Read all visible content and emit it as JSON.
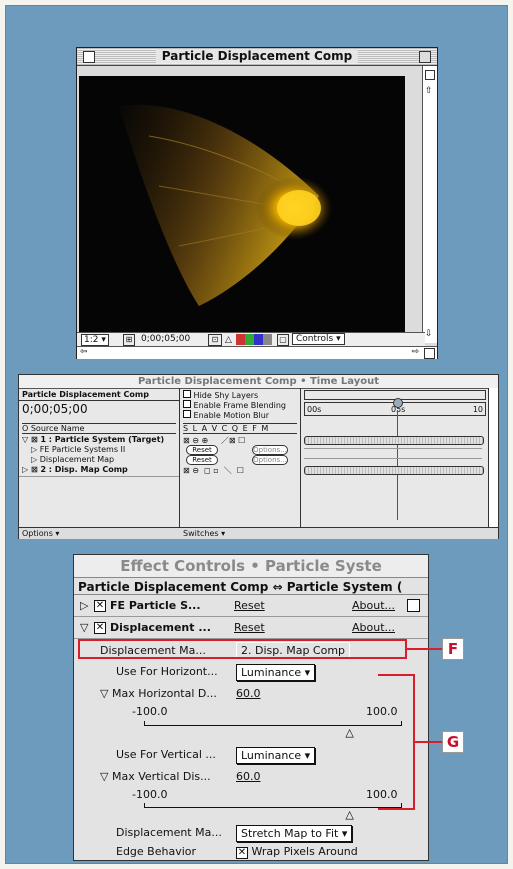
{
  "comp_window": {
    "title": "Particle Displacement Comp",
    "status": {
      "zoom": "1:2",
      "timecode": "0;00;05;00",
      "controls_label": "Controls"
    }
  },
  "time_layout": {
    "title": "Particle Displacement Comp • Time Layout",
    "comp_name": "Particle Displacement Comp",
    "timecode": "0;00;05;00",
    "options": [
      "Hide Shy Layers",
      "Enable Frame Blending",
      "Enable Motion Blur"
    ],
    "ruler": {
      "start": "00s",
      "mid": "05s",
      "end": "10"
    },
    "source_name_header": "O Source Name",
    "switch_header": "S L A V C Q E F M",
    "layers": [
      {
        "label": "1 : Particle System (Target)",
        "bold": true
      },
      {
        "label": "FE Particle Systems II",
        "reset": "Reset",
        "about": "Options..."
      },
      {
        "label": "Displacement Map",
        "reset": "Reset",
        "about": "Options..."
      },
      {
        "label": "2 : Disp. Map Comp",
        "bold": true
      }
    ],
    "footer": {
      "options": "Options",
      "switches": "Switches"
    }
  },
  "effect_controls": {
    "title": "Effect Controls • Particle Syste",
    "comp_line": "Particle Displacement Comp ⇔ Particle System (",
    "rows": {
      "fe_particle": {
        "name": "FE Particle S...",
        "reset": "Reset",
        "about": "About..."
      },
      "displacement": {
        "name": "Displacement ...",
        "reset": "Reset",
        "about": "About..."
      },
      "disp_map_layer": {
        "label": "Displacement Ma...",
        "value": "2. Disp. Map Comp"
      },
      "use_horizontal": {
        "label": "Use For Horizont...",
        "value": "Luminance"
      },
      "max_horizontal": {
        "label": "Max Horizontal D...",
        "value": "60.0",
        "min": "-100.0",
        "max": "100.0"
      },
      "use_vertical": {
        "label": "Use For Vertical ...",
        "value": "Luminance"
      },
      "max_vertical": {
        "label": "Max Vertical Dis...",
        "value": "60.0",
        "min": "-100.0",
        "max": "100.0"
      },
      "disp_map_behavior": {
        "label": "Displacement Ma...",
        "value": "Stretch Map to Fit"
      },
      "edge_behavior": {
        "label": "Edge Behavior",
        "value": "Wrap Pixels Around"
      }
    },
    "slider_levels": {
      "horizontal": 0.8,
      "vertical": 0.8
    }
  },
  "callouts": {
    "f": "F",
    "g": "G"
  },
  "colors": {
    "background": "#6c9bbd",
    "callout_red": "#d81e2c",
    "particle": "#e6b800"
  }
}
